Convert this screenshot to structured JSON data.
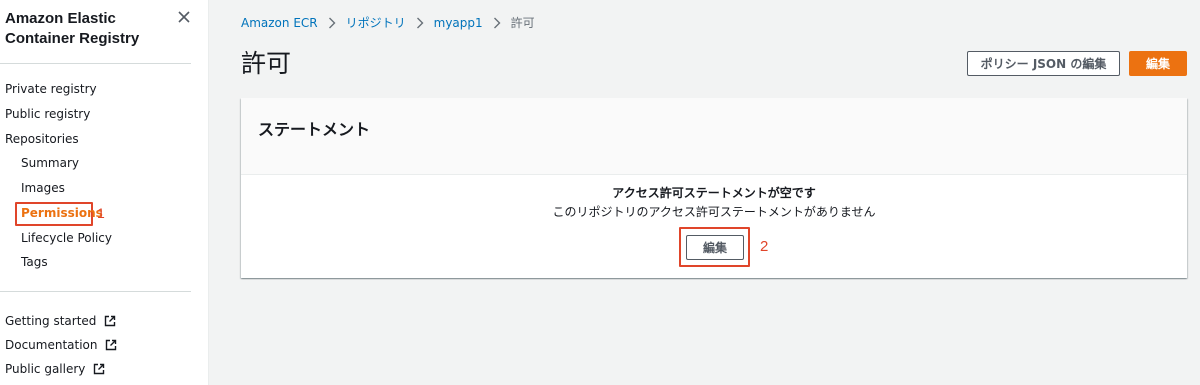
{
  "sidebar": {
    "title": "Amazon Elastic Container Registry",
    "nav_top": [
      "Private registry",
      "Public registry",
      "Repositories"
    ],
    "repo_sub": [
      "Summary",
      "Images",
      "Permissions",
      "Lifecycle Policy",
      "Tags"
    ],
    "active_item": "Permissions",
    "footer_links": [
      "Getting started",
      "Documentation",
      "Public gallery"
    ]
  },
  "annotations": {
    "marker_1": "1",
    "marker_2": "2",
    "highlight_color": "#e0452a"
  },
  "breadcrumb": [
    "Amazon ECR",
    "リポジトリ",
    "myapp1",
    "許可"
  ],
  "page": {
    "title": "許可",
    "btn_policy_json": "ポリシー JSON の編集",
    "btn_edit": "編集"
  },
  "panel": {
    "title": "ステートメント",
    "empty_title": "アクセス許可ステートメントが空です",
    "empty_desc": "このリポジトリのアクセス許可ステートメントがありません",
    "edit_button": "編集"
  },
  "colors": {
    "accent": "#ec7211",
    "link": "#0073bb",
    "text": "#16191f",
    "background": "#f2f3f3"
  }
}
